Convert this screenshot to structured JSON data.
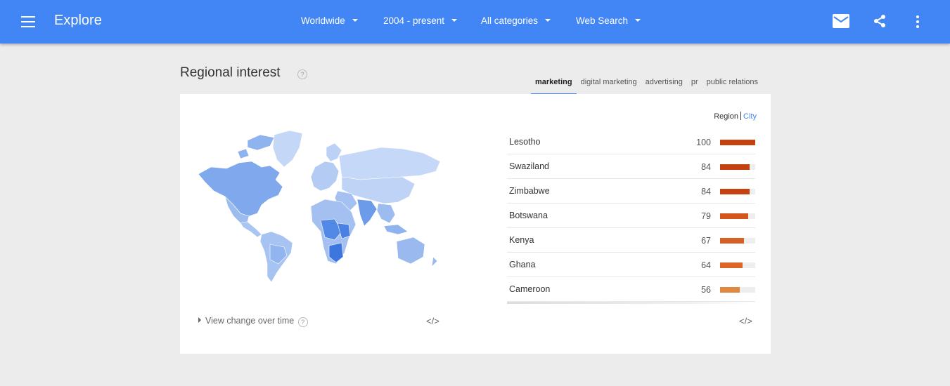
{
  "header": {
    "title": "Explore",
    "filters": [
      {
        "label": "Worldwide"
      },
      {
        "label": "2004 - present"
      },
      {
        "label": "All categories"
      },
      {
        "label": "Web Search"
      }
    ]
  },
  "section": {
    "title": "Regional interest",
    "help": "?",
    "tabs": [
      "marketing",
      "digital marketing",
      "advertising",
      "pr",
      "public relations"
    ],
    "active_tab": "marketing"
  },
  "toggle": {
    "region": "Region",
    "city": "City"
  },
  "rankings": [
    {
      "name": "Lesotho",
      "value": 100,
      "color": "#c5410f"
    },
    {
      "name": "Swaziland",
      "value": 84,
      "color": "#c5410f"
    },
    {
      "name": "Zimbabwe",
      "value": 84,
      "color": "#c5410f"
    },
    {
      "name": "Botswana",
      "value": 79,
      "color": "#d3561c"
    },
    {
      "name": "Kenya",
      "value": 67,
      "color": "#d65f24"
    },
    {
      "name": "Ghana",
      "value": 64,
      "color": "#da6726"
    },
    {
      "name": "Cameroon",
      "value": 56,
      "color": "#e08840"
    }
  ],
  "footer": {
    "view_change": "View change over time",
    "help": "?",
    "embed_left": "</>",
    "embed_right": "</>"
  },
  "colors": {
    "brand": "#4285f4",
    "bar_track": "#eeeeee"
  }
}
